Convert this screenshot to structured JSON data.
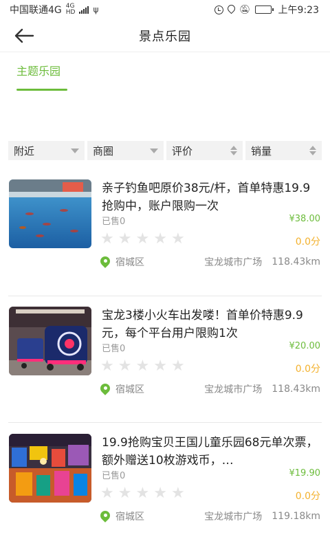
{
  "status_bar": {
    "carrier": "中国联通4G",
    "net_small_top": "4G",
    "net_small_bottom": "HD",
    "usb": "ψ",
    "time": "上午9:23"
  },
  "header": {
    "title": "景点乐园",
    "back_icon": "arrow-left-icon"
  },
  "tabs": [
    {
      "label": "主题乐园",
      "active": true
    }
  ],
  "filters": [
    {
      "label": "附近",
      "icon": "triangle-down-icon"
    },
    {
      "label": "商圈",
      "icon": "triangle-down-icon"
    },
    {
      "label": "评价",
      "icon": "sort-arrows-icon"
    },
    {
      "label": "销量",
      "icon": "sort-arrows-icon"
    }
  ],
  "products": [
    {
      "title": "亲子钓鱼吧原价38元/杆，首单特惠19.9抢购中，账户限购一次",
      "sold": "已售0",
      "price": "¥38.00",
      "score": "0.0分",
      "rating": 0,
      "district": "宿城区",
      "mall": "宝龙城市广场",
      "distance": "118.43km"
    },
    {
      "title": "宝龙3楼小火车出发喽！首单价特惠9.9元，每个平台用户限购1次",
      "sold": "已售0",
      "price": "¥20.00",
      "score": "0.0分",
      "rating": 0,
      "district": "宿城区",
      "mall": "宝龙城市广场",
      "distance": "118.43km"
    },
    {
      "title": "19.9抢购宝贝王国儿童乐园68元单次票，额外赠送10枚游戏币，…",
      "sold": "已售0",
      "price": "¥19.90",
      "score": "0.0分",
      "rating": 0,
      "district": "宿城区",
      "mall": "宝龙城市广场",
      "distance": "119.18km"
    }
  ],
  "colors": {
    "accent": "#6cbc3b",
    "score": "#f3b12d",
    "muted": "#999999"
  }
}
